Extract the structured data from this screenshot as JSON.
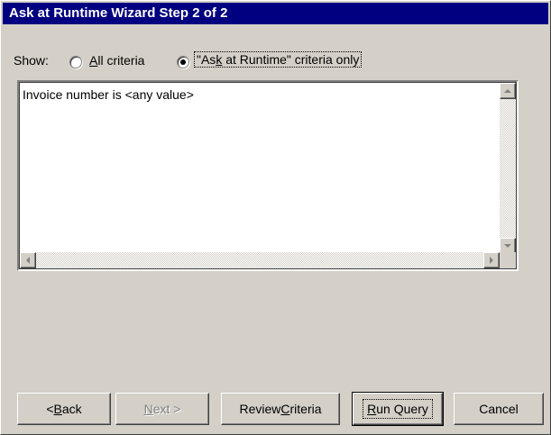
{
  "window": {
    "title": "Ask at Runtime Wizard Step 2 of 2"
  },
  "show": {
    "label": "Show:",
    "options": [
      {
        "label_accel": "A",
        "label_rest": "ll criteria",
        "selected": false
      },
      {
        "label_pre": "\"As",
        "label_accel": "k",
        "label_rest": " at Runtime\" criteria only",
        "selected": true
      }
    ]
  },
  "criteria_list": {
    "items": [
      "Invoice number is <any value>"
    ]
  },
  "buttons": {
    "back": {
      "pre": "< ",
      "accel": "B",
      "rest": "ack",
      "enabled": true
    },
    "next": {
      "accel": "N",
      "rest": "ext >",
      "enabled": false
    },
    "review": {
      "pre": "Review ",
      "accel": "C",
      "rest": "riteria",
      "enabled": true
    },
    "run": {
      "accel": "R",
      "rest": "un Query",
      "enabled": true,
      "default": true
    },
    "cancel": {
      "label": "Cancel",
      "enabled": true
    }
  },
  "colors": {
    "titlebar": "#000080",
    "face": "#d4d0c8"
  },
  "icons": [
    "radio-unselected-icon",
    "radio-selected-icon",
    "scroll-up-icon",
    "scroll-down-icon",
    "scroll-left-icon",
    "scroll-right-icon"
  ]
}
